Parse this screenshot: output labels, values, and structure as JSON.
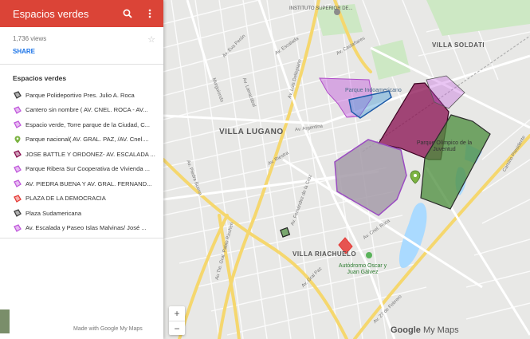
{
  "header": {
    "title": "Espacios verdes"
  },
  "meta": {
    "views": "1,736 views",
    "share": "SHARE"
  },
  "layer": {
    "name": "Espacios verdes",
    "items": [
      {
        "label": "Parque Polideportivo Pres. Julio A. Roca",
        "type": "polygon",
        "color": "#3c3c3c"
      },
      {
        "label": "Cantero sin nombre ( AV. CNEL. ROCA  - AV...",
        "type": "polygon",
        "color": "#c158dc"
      },
      {
        "label": "Espacio verde, Torre parque de la Ciudad, C...",
        "type": "polygon",
        "color": "#c158dc"
      },
      {
        "label": "Parque nacional( AV. GRAL. PAZ, /AV. Cnel....",
        "type": "pin",
        "color": "#7cb342"
      },
      {
        "label": "JOSE BATTLE Y ORDONEZ- AV. ESCALADA ...",
        "type": "polygon",
        "color": "#880e4f"
      },
      {
        "label": "Parque Ribera Sur Cooperativa de Vivienda ...",
        "type": "polygon",
        "color": "#c158dc"
      },
      {
        "label": "AV. PIEDRA BUENA Y AV. GRAL. FERNAND...",
        "type": "polygon",
        "color": "#c158dc"
      },
      {
        "label": "PLAZA DE LA DEMOCRACIA",
        "type": "polygon",
        "color": "#e53935"
      },
      {
        "label": "Plaza Sudamericana",
        "type": "polygon",
        "color": "#3c3c3c"
      },
      {
        "label": "Av. Escalada y Paseo Islas Malvinas/ José ...",
        "type": "polygon",
        "color": "#c158dc"
      }
    ]
  },
  "footer": {
    "made_with": "Made with Google My Maps"
  },
  "brand": {
    "google": "Google",
    "mymaps": "My Maps"
  },
  "zoom": {
    "in": "+",
    "out": "−"
  },
  "map": {
    "districts": [
      "VILLA LUGANO",
      "VILLA SOLDATI",
      "VILLA RIACHUELO"
    ],
    "pois": [
      "INSTITUTO SUPERIOR DE...",
      "Parque Indoamericano",
      "Parque Olímpico de la Juventud",
      "Autódromo Oscar y Juan Gálvez"
    ],
    "streets": [
      "Av. Escalada",
      "Av. Luis Dellepiane",
      "Av. Argentina",
      "Av. Larrazábal",
      "Av. Gral Paz",
      "Av. Cnel. Roca",
      "Av. 27 de Febrero",
      "Camino Presidente",
      "Av. Fernández de la Cruz",
      "Murguiondo",
      "Av. Piedra Buena",
      "Av. Castañares",
      "Av. Riestra",
      "Av. Eva Perón",
      "Au Tte. Gral. Pablo Riccheri"
    ]
  }
}
